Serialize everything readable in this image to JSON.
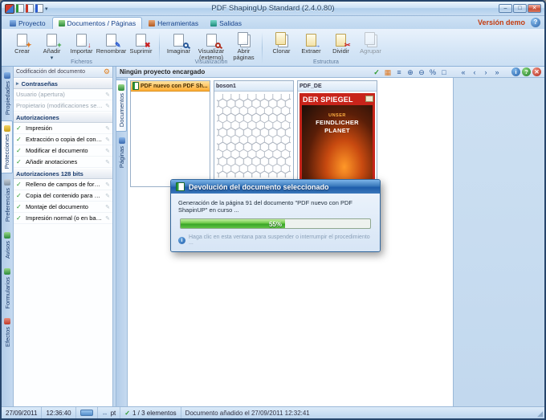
{
  "window": {
    "title": "PDF ShapingUp Standard (2.4.0.80)",
    "version_label": "Versión demo"
  },
  "ribbon": {
    "tabs": [
      "Proyecto",
      "Documentos / Páginas",
      "Herramientas",
      "Salidas"
    ],
    "groups": {
      "ficheros": {
        "label": "Ficheros",
        "buttons": [
          "Crear",
          "Añadir",
          "Importar",
          "Renombrar",
          "Suprimir"
        ]
      },
      "visualizacion": {
        "label": "Visualización",
        "buttons": [
          "Imaginar",
          "Visualizar (externo)",
          "Abrir páginas"
        ]
      },
      "estructura": {
        "label": "Estructura",
        "buttons": [
          "Clonar",
          "Extraer",
          "Dividir",
          "Agrupar"
        ]
      }
    }
  },
  "sidebar": {
    "tabs": [
      "Propiedades",
      "Protecciones",
      "Preferencias",
      "Avisos",
      "Formularios",
      "Efectos"
    ],
    "panel": {
      "header": "Codificación del documento",
      "rows": [
        {
          "label": "Contraseñas"
        },
        {
          "label": "Usuario (apertura)"
        },
        {
          "label": "Propietario (modificaciones según autorizaciones)"
        },
        {
          "label": "Autorizaciones"
        },
        {
          "label": "Impresión"
        },
        {
          "label": "Extracción o copia del contenido"
        },
        {
          "label": "Modificar el documento"
        },
        {
          "label": "Añadir anotaciones"
        },
        {
          "label": "Autorizaciones 128 bits"
        },
        {
          "label": "Relleno de campos de formulario"
        },
        {
          "label": "Copia del contenido para accesibilidad"
        },
        {
          "label": "Montaje del documento"
        },
        {
          "label": "Impresión normal (o en baja resolución)"
        }
      ]
    }
  },
  "main": {
    "header": "Ningún proyecto encargado",
    "side_tabs": [
      "Documentos",
      "Páginas"
    ],
    "documents": [
      {
        "title": "PDF nuevo con PDF Sh..."
      },
      {
        "title": "boson1"
      },
      {
        "title": "PDF_DE"
      }
    ],
    "magazine_cover": {
      "masthead": "DER SPIEGEL",
      "headline1": "UNSER",
      "headline2": "FEINDLICHER",
      "headline3": "PLANET"
    }
  },
  "dialog": {
    "title": "Devolución del documento seleccionado",
    "message": "Generación de la página 91 del documento \"PDF nuevo con PDF ShapinUP\" en curso ...",
    "progress_percent": 55,
    "progress_label": "55%",
    "note": "Haga clic en esta ventana para suspender o interrumpir el procedimiento ..."
  },
  "statusbar": {
    "date": "27/09/2011",
    "time": "12:36:40",
    "unit": "pt",
    "elements": "1 / 3 elementos",
    "message": "Documento añadido el 27/09/2011 12:32:41"
  },
  "icons": {
    "gear": "⚙",
    "check": "✓",
    "arrow": "▸",
    "dropdown": "▾",
    "help": "?",
    "info": "i",
    "pencil": "✎",
    "plus": "+",
    "down": "↓",
    "cross": "✖",
    "scissors": "✂",
    "spark": "✦",
    "extract": "→",
    "zoom_in": "⊕",
    "zoom_out": "⊖",
    "percent": "%",
    "grid": "▦",
    "list": "≡",
    "fit": "□",
    "first": "«",
    "prev": "‹",
    "next": "›",
    "last": "»",
    "ruler": "↔",
    "min": "–",
    "max": "□",
    "close": "✕"
  },
  "colors": {
    "accent_blue": "#3a6ea5",
    "selection_orange": "#ffae35",
    "progress_green": "#3aa428",
    "demo_red": "#c33c10",
    "spiegel_red": "#c8241a"
  }
}
